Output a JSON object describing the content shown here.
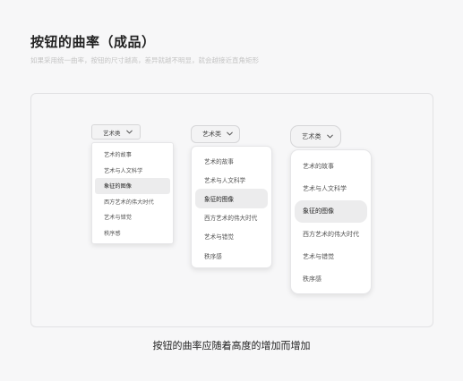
{
  "page": {
    "title": "按钮的曲率（成品）",
    "subtitle": "如果采用统一曲率，按钮的尺寸越高，差异就越不明显，就会越接近直角矩形"
  },
  "dropdowns": [
    {
      "trigger_label": "艺术类",
      "chevron_icon": "chevron-down-icon",
      "options": [
        "艺术的故事",
        "艺术与人文科学",
        "象征的图像",
        "西方艺术的伟大时代",
        "艺术与错觉",
        "秩序感"
      ],
      "selected": "象征的图像"
    },
    {
      "trigger_label": "艺术类",
      "chevron_icon": "chevron-down-icon",
      "options": [
        "艺术的故事",
        "艺术与人文科学",
        "象征的图像",
        "西方艺术的伟大时代",
        "艺术与错觉",
        "秩序感"
      ],
      "selected": "象征的图像"
    },
    {
      "trigger_label": "艺术类",
      "chevron_icon": "chevron-down-icon",
      "options": [
        "艺术的故事",
        "艺术与人文科学",
        "象征的图像",
        "西方艺术的伟大时代",
        "艺术与错觉",
        "秩序感"
      ],
      "selected": "象征的图像"
    }
  ],
  "caption": "按钮的曲率应随着高度的增加而增加",
  "colors": {
    "background": "#f7f7f8",
    "selected_item": "#ececed",
    "trigger_bg": "#f3f3f4",
    "subtitle_text": "#c4c4c4"
  }
}
